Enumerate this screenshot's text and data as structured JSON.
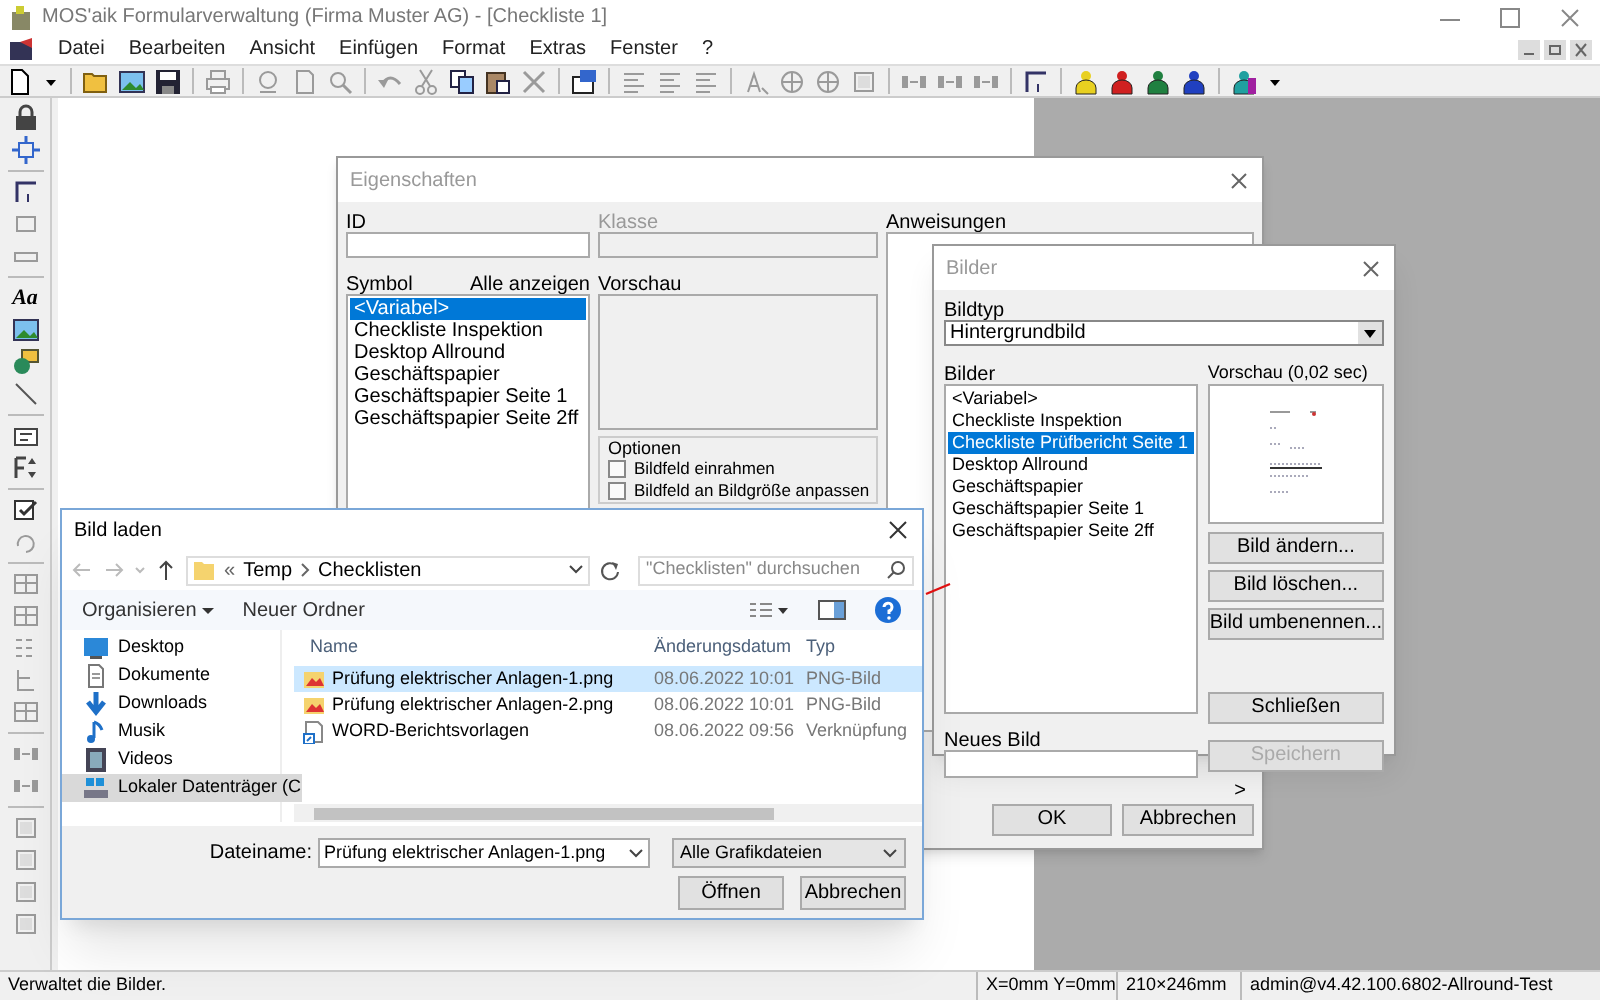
{
  "window": {
    "title": "MOS'aik Formularverwaltung (Firma Muster AG) - [Checkliste 1]"
  },
  "menu": [
    "Datei",
    "Bearbeiten",
    "Ansicht",
    "Einfügen",
    "Format",
    "Extras",
    "Fenster",
    "?"
  ],
  "left_toolbar": {
    "text_tool_label": "Aa"
  },
  "properties_dialog": {
    "title": "Eigenschaften",
    "fields": [
      {
        "label": "ID",
        "disabled": false
      },
      {
        "label": "Klasse",
        "disabled": true
      }
    ],
    "instructions_label": "Anweisungen",
    "symbol_label": "Symbol",
    "show_all": "Alle anzeigen",
    "symbols": [
      {
        "label": "<Variabel>",
        "selected": true
      },
      {
        "label": "Checkliste Inspektion",
        "selected": false
      },
      {
        "label": "Desktop Allround",
        "selected": false
      },
      {
        "label": "Geschäftspapier",
        "selected": false
      },
      {
        "label": "Geschäftspapier Seite 1",
        "selected": false
      },
      {
        "label": "Geschäftspapier Seite 2ff",
        "selected": false
      }
    ],
    "preview_label": "Vorschau",
    "options": {
      "title": "Optionen",
      "items": [
        {
          "label": "Bildfeld einrahmen",
          "checked": false
        },
        {
          "label": "Bildfeld an Bildgröße anpassen",
          "checked": false
        }
      ]
    },
    "more": ">",
    "buttons": [
      "OK",
      "Abbrechen"
    ]
  },
  "images_dialog": {
    "title": "Bilder",
    "type_label": "Bildtyp",
    "type_value": "Hintergrundbild",
    "list_label": "Bilder",
    "images": [
      {
        "label": "<Variabel>",
        "selected": false
      },
      {
        "label": "Checkliste Inspektion",
        "selected": false
      },
      {
        "label": "Checkliste Prüfbericht Seite 1",
        "selected": true
      },
      {
        "label": "Desktop Allround",
        "selected": false
      },
      {
        "label": "Geschäftspapier",
        "selected": false
      },
      {
        "label": "Geschäftspapier Seite 1",
        "selected": false
      },
      {
        "label": "Geschäftspapier Seite 2ff",
        "selected": false
      }
    ],
    "preview_label": "Vorschau (0,02 sec)",
    "actions": [
      {
        "label": "Bild ändern...",
        "disabled": false
      },
      {
        "label": "Bild löschen...",
        "disabled": false
      },
      {
        "label": "Bild umbenennen...",
        "disabled": false
      },
      {
        "label": "Schließen",
        "disabled": false
      },
      {
        "label": "Speichern",
        "disabled": true
      }
    ],
    "new_label": "Neues Bild"
  },
  "load_dialog": {
    "title": "Bild laden",
    "path_prefix": "«",
    "path": [
      "Temp",
      "Checklisten"
    ],
    "search": {
      "placeholder": "\"Checklisten\" durchsuchen"
    },
    "toolbar": [
      "Organisieren",
      "Neuer Ordner"
    ],
    "nav": [
      {
        "label": "Desktop",
        "kind": "desktop",
        "selected": false
      },
      {
        "label": "Dokumente",
        "kind": "documents",
        "selected": false
      },
      {
        "label": "Downloads",
        "kind": "downloads",
        "selected": false
      },
      {
        "label": "Musik",
        "kind": "music",
        "selected": false
      },
      {
        "label": "Videos",
        "kind": "videos",
        "selected": false
      },
      {
        "label": "Lokaler Datenträger (C",
        "kind": "drive",
        "selected": true
      }
    ],
    "columns": [
      "Name",
      "Änderungsdatum",
      "Typ"
    ],
    "files": [
      {
        "name": "Prüfung elektrischer Anlagen-1.png",
        "date": "08.06.2022 10:01",
        "type": "PNG-Bild",
        "kind": "image",
        "selected": true
      },
      {
        "name": "Prüfung elektrischer Anlagen-2.png",
        "date": "08.06.2022 10:01",
        "type": "PNG-Bild",
        "kind": "image",
        "selected": false
      },
      {
        "name": "WORD-Berichtsvorlagen",
        "date": "08.06.2022 09:56",
        "type": "Verknüpfung",
        "kind": "shortcut",
        "selected": false
      }
    ],
    "filename_label": "Dateiname:",
    "filename": "Prüfung elektrischer Anlagen-1.png",
    "filter": "Alle Grafikdateien",
    "buttons": [
      "Öffnen",
      "Abbrechen"
    ]
  },
  "status_bar": [
    "Verwaltet die Bilder.",
    "X=0mm Y=0mm",
    "210×246mm",
    "admin@v4.42.100.6802-Allround-Test"
  ]
}
